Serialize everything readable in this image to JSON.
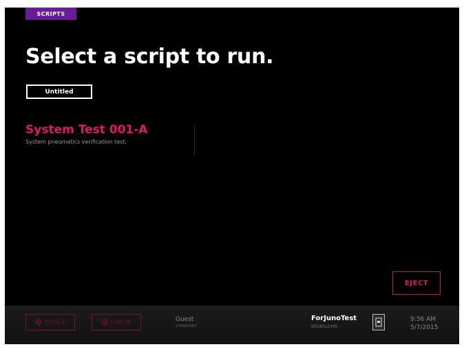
{
  "header": {
    "section_tag": "SCRIPTS",
    "title": "Select a script to run."
  },
  "filter": {
    "label": "Untitled"
  },
  "scripts": [
    {
      "name": "System Test 001-A",
      "description": "System pneumatics verification test."
    }
  ],
  "actions": {
    "eject_label": "EJECT"
  },
  "bottom_bar": {
    "tools_label": "TOOLS",
    "tools_icon": "gear-icon",
    "login_label": "LOG IN",
    "login_icon": "login-arrow-icon",
    "user_name": "Guest",
    "user_role": "STANDARD",
    "device_name": "ForJunoTest",
    "device_id": "0018012345",
    "device_icon": "device-icon",
    "time": "9:56 AM",
    "date": "5/7/2015"
  },
  "colors": {
    "background": "#000000",
    "accent_pink": "#e0186c",
    "tag_purple": "#6a1b9a",
    "muted_pink": "#7a1038"
  }
}
